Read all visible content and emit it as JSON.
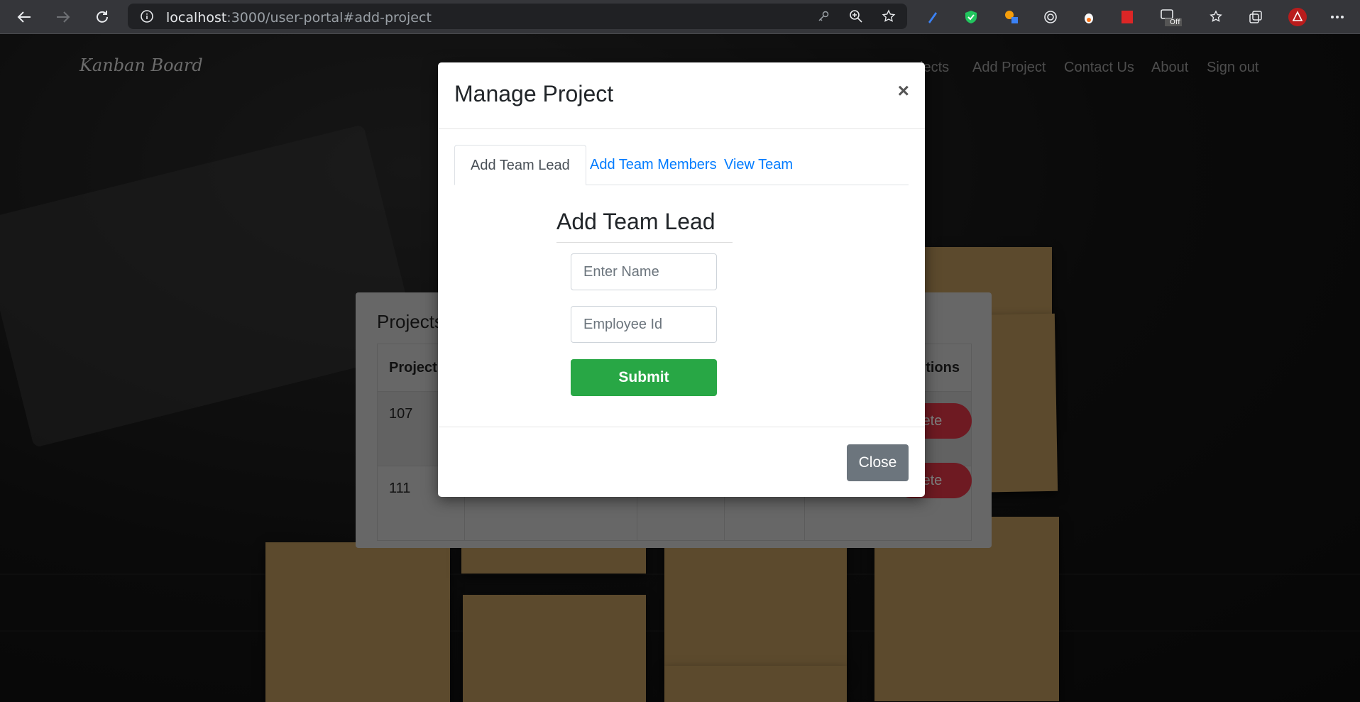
{
  "browser": {
    "url_host": "localhost",
    "url_path": ":3000/user-portal#add-project",
    "icons": {
      "back": "arrow-left-icon",
      "forward": "arrow-right-icon",
      "reload": "reload-icon",
      "info": "info-icon"
    },
    "extension_badge_off": "Off"
  },
  "site": {
    "brand": "Kanban Board",
    "nav": {
      "projects_partial": "jects",
      "add_project": "Add Project",
      "contact_us": "Contact Us",
      "about": "About",
      "sign_out": "Sign out"
    }
  },
  "projects_card": {
    "title_partial": "Projects",
    "col_project_partial": "Project",
    "col_actions_partial": "tions",
    "rows": [
      {
        "id": "107",
        "delete_partial": "lete"
      },
      {
        "id": "111",
        "delete_partial": "lete"
      }
    ]
  },
  "modal": {
    "title": "Manage Project",
    "close_x": "×",
    "tabs": [
      {
        "label": "Add Team Lead"
      },
      {
        "label": "Add Team Members"
      },
      {
        "label": "View Team"
      }
    ],
    "form_title": "Add Team Lead",
    "name_placeholder": "Enter Name",
    "employee_placeholder": "Employee Id",
    "submit_label": "Submit",
    "close_label": "Close"
  },
  "colors": {
    "accent": "#007bff",
    "submit": "#28a745",
    "close": "#6c757d",
    "delete": "#dc3545"
  }
}
